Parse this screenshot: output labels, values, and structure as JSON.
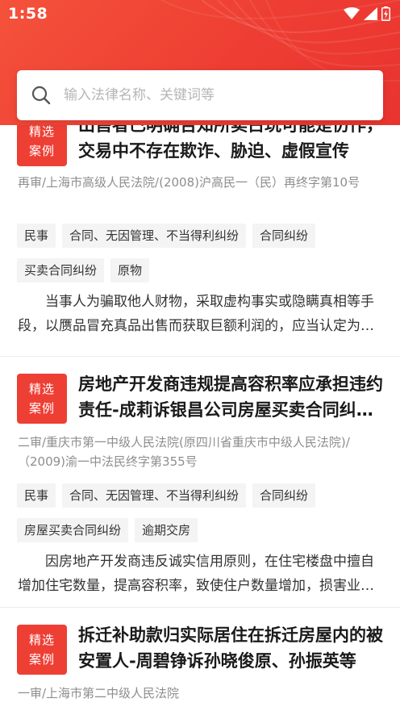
{
  "status_bar": {
    "time": "1:58"
  },
  "search": {
    "placeholder": "输入法律名称、关键词等"
  },
  "cases": [
    {
      "badge": [
        "精选",
        "案例"
      ],
      "title": "出售者已明确告知所卖古玩可能是仿作，交易中不存在欺诈、胁迫、虚假宣传",
      "source": "再审/上海市高级人民法院/(2008)沪高民一（民）再终字第10号",
      "tag_rows": [
        [
          "民事",
          "合同、无因管理、不当得利纠纷",
          "合同纠纷"
        ],
        [
          "买卖合同纠纷",
          "原物"
        ]
      ],
      "summary": "当事人为骗取他人财物，采取虚构事实或隐瞒真相等手段，以赝品冒充真品出售而获取巨额利润的，应当认定为欺诈"
    },
    {
      "badge": [
        "精选",
        "案例"
      ],
      "title": "房地产开发商违规提高容积率应承担违约责任-成莉诉银昌公司房屋买卖合同纠纷案",
      "source": "二审/重庆市第一中级人民法院(原四川省重庆市中级人民法院)/（2009)渝一中法民终字第355号",
      "tag_rows": [
        [
          "民事",
          "合同、无因管理、不当得利纠纷",
          "合同纠纷"
        ],
        [
          "房屋买卖合同纠纷",
          "逾期交房"
        ]
      ],
      "summary": "因房地产开发商违反诚实信用原则，在住宅楼盘中擅自增加住宅数量，提高容积率，致使住户数量增加，损害业主利益"
    },
    {
      "badge": [
        "精选",
        "案例"
      ],
      "title": "拆迁补助款归实际居住在拆迁房屋内的被安置人-周碧铮诉孙晓俊原、孙振英等",
      "source": "一审/上海市第二中级人民法院",
      "tag_rows": [],
      "summary": ""
    }
  ]
}
